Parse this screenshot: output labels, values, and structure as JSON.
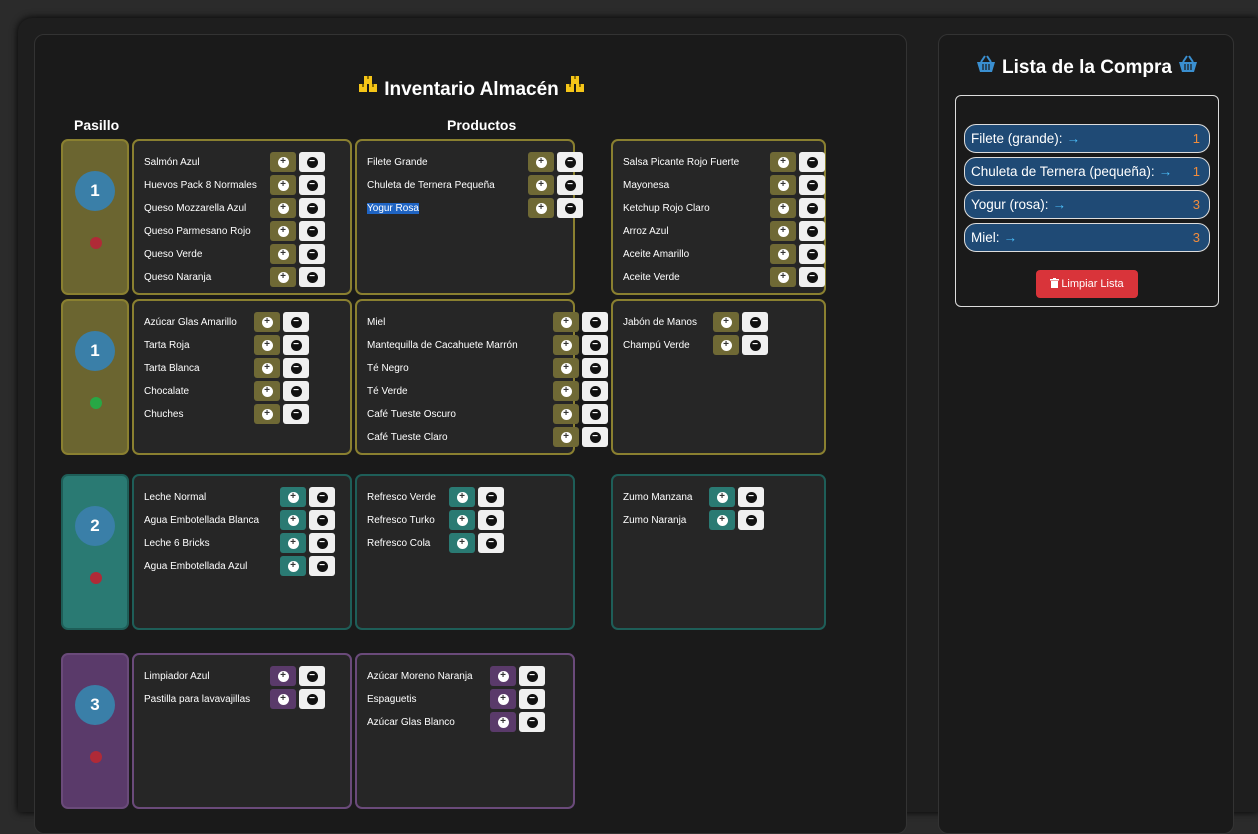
{
  "inventory": {
    "title": "Inventario Almacén",
    "col_pasillo": "Pasillo",
    "col_productos": "Productos"
  },
  "colors": {
    "aisle1": "#6b6530",
    "aisle2": "#2a7a73",
    "aisle3": "#5a3a6a",
    "accent": "#3a7fa8",
    "danger": "#d9343a"
  },
  "aisles": [
    {
      "number": "1",
      "status": "red",
      "cells": [
        [
          "Salmón Azul",
          "Huevos Pack 8 Normales",
          "Queso Mozzarella Azul",
          "Queso Parmesano Rojo",
          "Queso Verde",
          "Queso Naranja"
        ],
        [
          "Filete Grande",
          "Chuleta de Ternera Pequeña",
          "Yogur Rosa"
        ],
        [
          "Salsa Picante Rojo Fuerte",
          "Mayonesa",
          "Ketchup Rojo Claro",
          "Arroz Azul",
          "Aceite Amarillo",
          "Aceite Verde"
        ]
      ]
    },
    {
      "number": "1",
      "status": "green",
      "cells": [
        [
          "Azúcar Glas Amarillo",
          "Tarta Roja",
          "Tarta Blanca",
          "Chocalate",
          "Chuches"
        ],
        [
          "Miel",
          "Mantequilla de Cacahuete Marrón",
          "Té Negro",
          "Té Verde",
          "Café Tueste Oscuro",
          "Café Tueste Claro"
        ],
        [
          "Jabón de Manos",
          "Champú Verde"
        ]
      ]
    },
    {
      "number": "2",
      "status": "red",
      "cells": [
        [
          "Leche Normal",
          "Agua Embotellada Blanca",
          "Leche 6 Bricks",
          "Agua Embotellada Azul"
        ],
        [
          "Refresco Verde",
          "Refresco Turko",
          "Refresco Cola"
        ],
        [
          "Zumo Manzana",
          "Zumo Naranja"
        ]
      ]
    },
    {
      "number": "3",
      "status": "red",
      "cells": [
        [
          "Limpiador Azul",
          "Pastilla para lavavajillas"
        ],
        [
          "Azúcar Moreno Naranja",
          "Espaguetis",
          "Azúcar Glas Blanco"
        ]
      ]
    }
  ],
  "shopping": {
    "title": "Lista de la Compra",
    "items": [
      {
        "label": "Filete (grande):",
        "qty": "1"
      },
      {
        "label": "Chuleta de Ternera (pequeña):",
        "qty": "1"
      },
      {
        "label": "Yogur (rosa):",
        "qty": "3"
      },
      {
        "label": "Miel:",
        "qty": "3"
      }
    ],
    "clear_label": "Limpiar Lista"
  }
}
